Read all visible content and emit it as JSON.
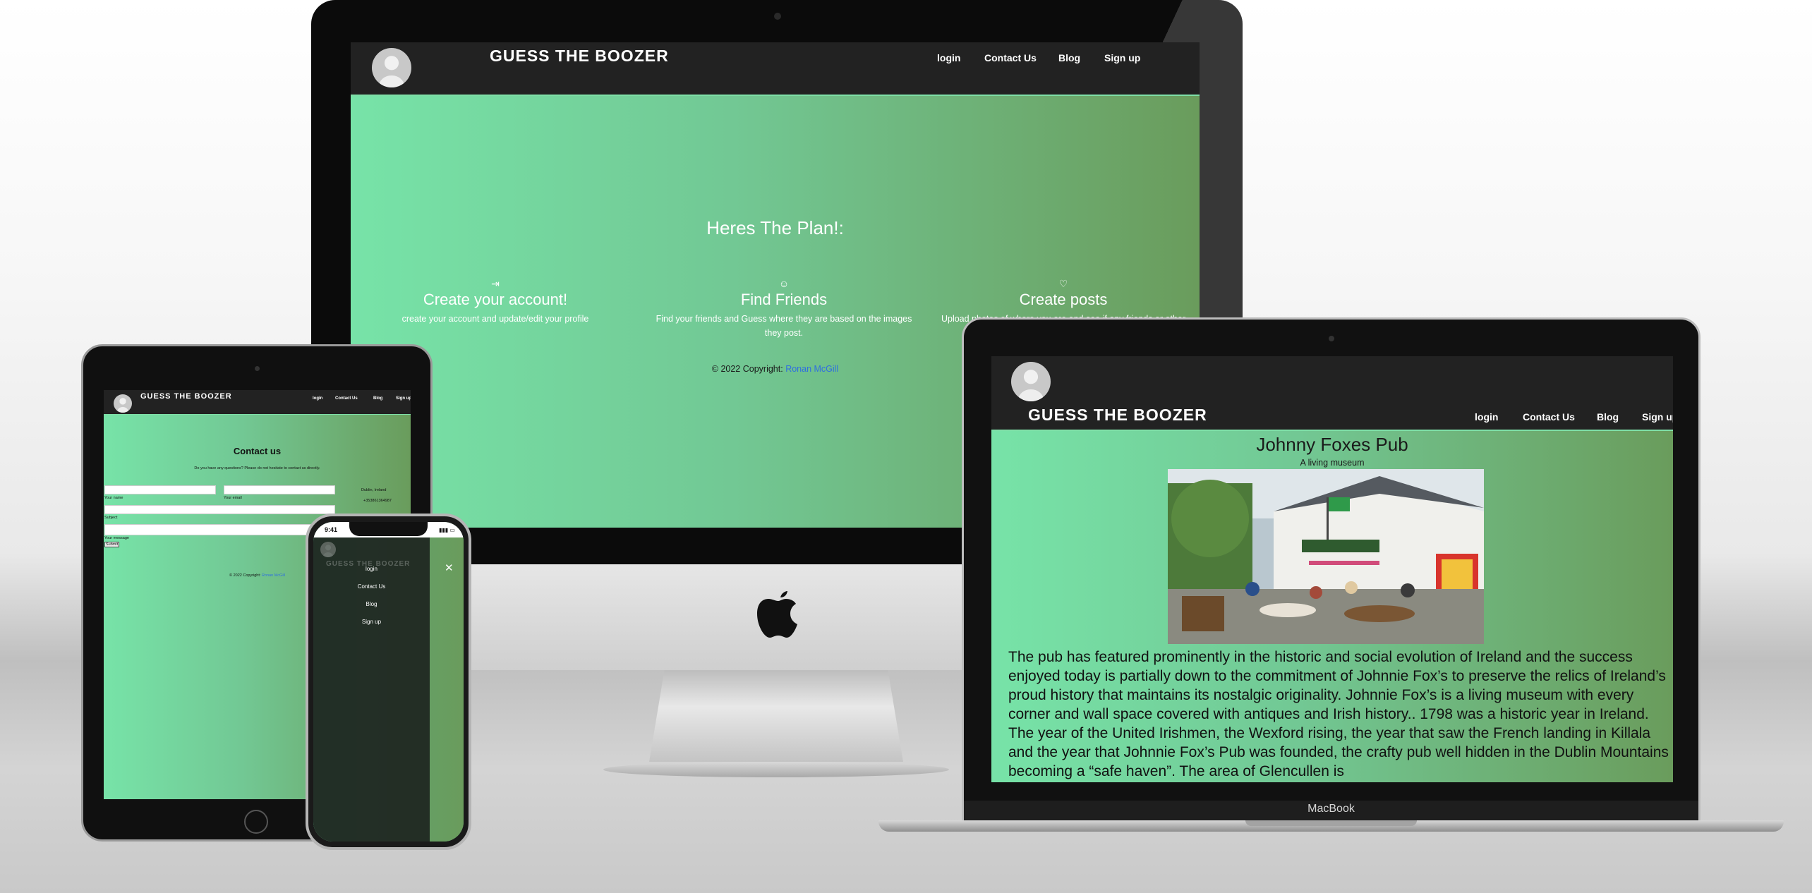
{
  "site": {
    "brand": "GUESS THE BOOZER",
    "nav": [
      "login",
      "Contact Us",
      "Blog",
      "Sign up"
    ]
  },
  "home": {
    "heading": "Heres The Plan!:",
    "features": [
      {
        "icon": "sign-in-icon",
        "title": "Create your account!",
        "text": "create your account and update/edit your profile"
      },
      {
        "icon": "smiley-icon",
        "title": "Find Friends",
        "text": "Find your friends and Guess where they are based on the images they post."
      },
      {
        "icon": "heart-icon",
        "title": "Create posts",
        "text": "Upload photos of where you are and see if any friends or other users can Guess"
      }
    ],
    "copyright": "© 2022 Copyright:",
    "author": "Ronan McGill"
  },
  "blog": {
    "title": "Johnny Foxes Pub",
    "subtitle": "A living museum",
    "body": "The pub has featured prominently in the historic and social evolution of Ireland and the success enjoyed today is partially down to the commitment of Johnnie Fox’s to preserve the relics of Ireland’s proud history that maintains its nostalgic originality. Johnnie Fox’s is a living museum with every corner and wall space covered with antiques and Irish history.. 1798 was a historic year in Ireland. The year of the United Irishmen, the Wexford rising, the year that saw the French landing in Killala and the year that Johnnie Fox’s Pub was founded, the crafty pub well hidden in the Dublin Mountains becoming a “safe haven”. The area of Glencullen is"
  },
  "contact": {
    "title": "Contact us",
    "intro": "Do you have any questions? Please do not hesitate to contact us directly.",
    "name_label": "Your name",
    "email_label": "Your email",
    "subject_label": "Subject",
    "message_label": "Your message",
    "submit": "Submit",
    "address": "Dublin, Ireland",
    "phone": "+353861364987",
    "copyright": "© 2022 Copyright:",
    "author": "Ronan McGill"
  },
  "phone": {
    "time": "9:41",
    "close_symbol": "✕"
  },
  "device": {
    "laptop_label": "MacBook"
  },
  "colors": {
    "nav_bg": "#222222",
    "gradient_start": "#77e3a8",
    "gradient_end": "#6a9c5c",
    "link": "#2f6fe0"
  }
}
